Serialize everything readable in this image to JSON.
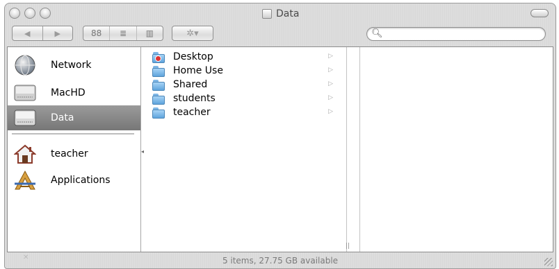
{
  "window": {
    "title": "Data"
  },
  "toolbar": {
    "back_label": "◀",
    "forward_label": "▶",
    "view_icons_label": "88",
    "view_list_label": "≣",
    "view_columns_label": "▥",
    "action_label": "✲▾",
    "search": {
      "value": "",
      "placeholder": ""
    }
  },
  "sidebar": {
    "items": [
      {
        "label": "Network",
        "icon": "network-globe-icon"
      },
      {
        "label": "MacHD",
        "icon": "hard-drive-icon"
      },
      {
        "label": "Data",
        "icon": "hard-drive-icon",
        "selected": true
      },
      {
        "label": "teacher",
        "icon": "home-icon"
      },
      {
        "label": "Applications",
        "icon": "applications-icon"
      }
    ]
  },
  "browser": {
    "column1": [
      {
        "label": "Desktop",
        "icon": "desktop-folder-icon"
      },
      {
        "label": "Home Use",
        "icon": "folder-icon"
      },
      {
        "label": "Shared",
        "icon": "folder-icon"
      },
      {
        "label": "students",
        "icon": "folder-icon"
      },
      {
        "label": "teacher",
        "icon": "folder-icon"
      }
    ],
    "arrow_glyph": "▷",
    "resize_glyph": "||"
  },
  "status": {
    "text": "5 items, 27.75 GB available"
  },
  "colors": {
    "selection": "#8a8a8a",
    "folder": "#6aaee6",
    "window_chrome": "#dcdcdc"
  }
}
